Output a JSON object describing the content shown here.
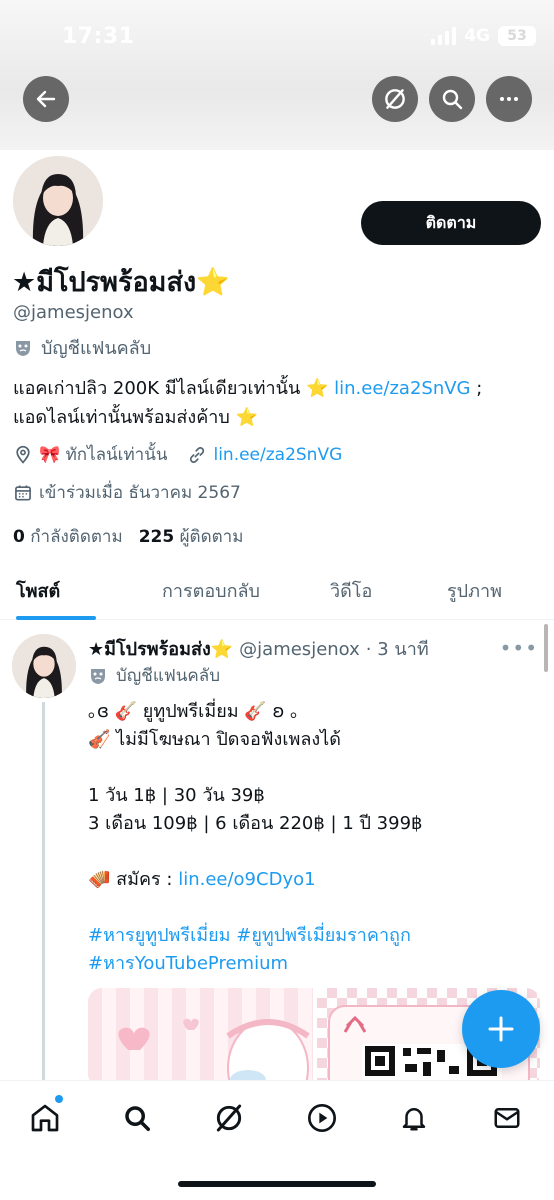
{
  "status_bar": {
    "time": "17:31",
    "network": "4G",
    "battery": "53"
  },
  "profile": {
    "name": "★มีโปรพร้อมส่ง⭐",
    "handle": "@jamesjenox",
    "fan_label": "บัญชีแฟนคลับ",
    "follow_label": "ติดตาม",
    "bio_text_1": "แอคเก่าปลิว 200K มีไลน์เดียวเท่านั้น ⭐ ",
    "bio_link": "lin.ee/za2SnVG",
    "bio_text_2": " ;",
    "bio_line_2": "แอดไลน์เท่านั้นพร้อมส่งค้าบ ⭐",
    "location": "🎀 ทักไลน์เท่านั้น",
    "website": "lin.ee/za2SnVG",
    "joined": "เข้าร่วมเมื่อ ธันวาคม 2567",
    "following_count": "0",
    "following_label": "กำลังติดตาม",
    "followers_count": "225",
    "followers_label": "ผู้ติดตาม"
  },
  "tabs": [
    "โพสต์",
    "การตอบกลับ",
    "วิดีโอ",
    "รูปภาพ"
  ],
  "post": {
    "name": "★มีโปรพร้อมส่ง⭐",
    "handle": "@jamesjenox",
    "time": "· 3 นาที",
    "fan_label": "บัญชีแฟนคลับ",
    "lines": [
      "｡‪ɞ‬ 🎸 ยูทูปพรีเมี่ยม 🎸 ‪ʚ‬ ｡",
      "🎻 ไม่มีโฆษณา ปิดจอฟังเพลงได้",
      "",
      "1 วัน 1฿ | 30 วัน 39฿",
      "3 เดือน 109฿ | 6 เดือน 220฿ | 1 ปี 399฿",
      ""
    ],
    "signup_label": "🪗 สมัคร : ",
    "signup_link": "lin.ee/o9CDyo1",
    "hashtags_1": "#หารยูทูปพรีเมี่ยม #ยูทูปพรีเมี่ยมราคาถูก",
    "hashtags_2": "#หารYouTubePremium"
  },
  "icons": {
    "header": [
      "back-arrow-icon",
      "grok-icon",
      "search-icon",
      "more-icon"
    ],
    "bottom_nav": [
      "home-icon",
      "search-icon",
      "grok-icon",
      "play-icon",
      "bell-icon",
      "mail-icon"
    ]
  },
  "colors": {
    "accent": "#1d9bf0",
    "text": "#0f1419",
    "secondary": "#536471",
    "follow_button": "#0f1419"
  }
}
